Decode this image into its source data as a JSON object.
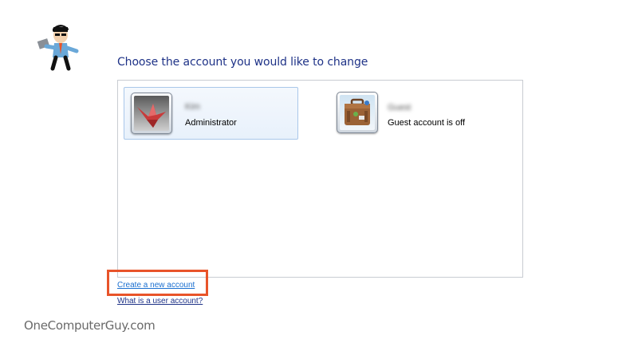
{
  "header": {
    "title": "Choose the account you would like to change"
  },
  "accounts": [
    {
      "name": "Kim",
      "type": "Administrator",
      "icon": "origami-crane-icon",
      "selected": true
    },
    {
      "name": "Guest",
      "type": "Guest account is off",
      "icon": "suitcase-icon",
      "selected": false
    }
  ],
  "links": {
    "create": "Create a new account",
    "what": "What is a user account?"
  },
  "annotation": {
    "highlight_color": "#e8542a"
  },
  "branding": {
    "logo_icon": "computer-guy-mascot-icon",
    "watermark": "OneComputerGuy.com"
  }
}
